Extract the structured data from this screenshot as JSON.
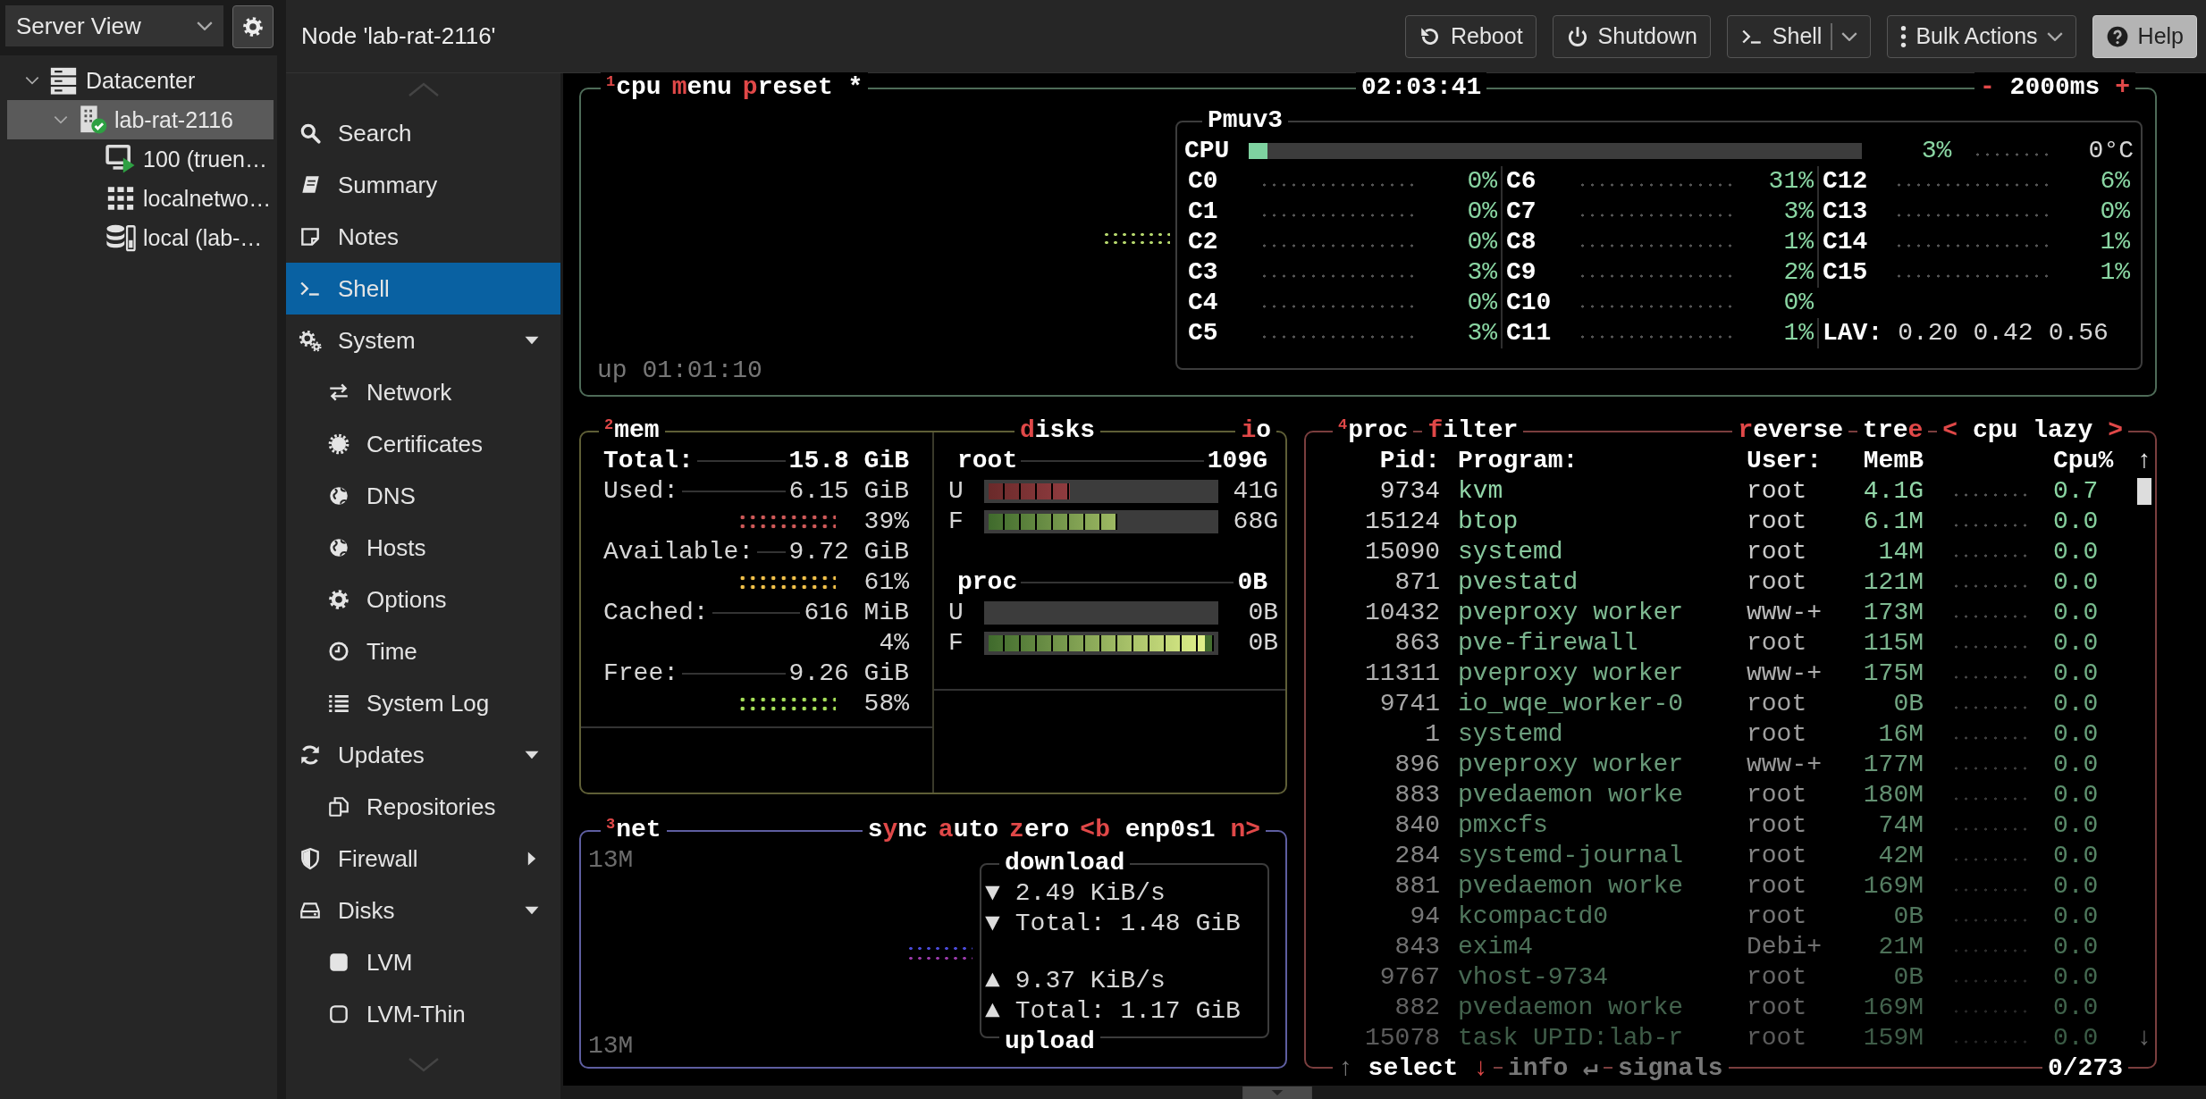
{
  "tree": {
    "view_selector": "Server View",
    "items": [
      {
        "label": "Datacenter",
        "kind": "datacenter",
        "selected": false,
        "expanded": true,
        "children": [
          {
            "label": "lab-rat-2116",
            "kind": "node",
            "selected": true,
            "expanded": true,
            "children": [
              {
                "label": "100 (truen…",
                "kind": "vm",
                "selected": false
              },
              {
                "label": "localnetwo…",
                "kind": "network",
                "selected": false
              },
              {
                "label": "local (lab-…",
                "kind": "storage",
                "selected": false
              }
            ]
          }
        ]
      }
    ]
  },
  "header": {
    "title": "Node 'lab-rat-2116'",
    "buttons": [
      {
        "label": "Reboot",
        "kind": "plain"
      },
      {
        "label": "Shutdown",
        "kind": "plain"
      },
      {
        "label": "Shell",
        "kind": "split"
      },
      {
        "label": "Bulk Actions",
        "kind": "dropdown"
      },
      {
        "label": "Help",
        "kind": "light"
      }
    ]
  },
  "nav": {
    "items": [
      {
        "label": "Search",
        "kind": "search",
        "selected": false
      },
      {
        "label": "Summary",
        "kind": "summary",
        "selected": false
      },
      {
        "label": "Notes",
        "kind": "notes",
        "selected": false
      },
      {
        "label": "Shell",
        "kind": "shell",
        "selected": true
      },
      {
        "label": "System",
        "kind": "system",
        "selected": false,
        "expanded": true,
        "children": [
          {
            "label": "Network",
            "kind": "network",
            "selected": false
          },
          {
            "label": "Certificates",
            "kind": "certificates",
            "selected": false
          },
          {
            "label": "DNS",
            "kind": "globe",
            "selected": false
          },
          {
            "label": "Hosts",
            "kind": "globe",
            "selected": false
          },
          {
            "label": "Options",
            "kind": "options",
            "selected": false
          },
          {
            "label": "Time",
            "kind": "time",
            "selected": false
          },
          {
            "label": "System Log",
            "kind": "log",
            "selected": false
          }
        ]
      },
      {
        "label": "Updates",
        "kind": "updates",
        "selected": false,
        "expanded": true,
        "children": [
          {
            "label": "Repositories",
            "kind": "repositories",
            "selected": false
          }
        ]
      },
      {
        "label": "Firewall",
        "kind": "firewall",
        "selected": false,
        "expanded": false
      },
      {
        "label": "Disks",
        "kind": "disks",
        "selected": false,
        "expanded": true,
        "children": [
          {
            "label": "LVM",
            "kind": "lvm",
            "selected": false
          },
          {
            "label": "LVM-Thin",
            "kind": "lvmthin",
            "selected": false
          }
        ]
      }
    ]
  },
  "cpu_panel": {
    "tabs": [
      {
        "number": "1",
        "parts": [
          {
            "text": "cpu",
            "kind": "text"
          }
        ]
      },
      {
        "parts": [
          {
            "text": "m",
            "kind": "key"
          },
          {
            "text": "enu",
            "kind": "text"
          }
        ]
      },
      {
        "parts": [
          {
            "text": "p",
            "kind": "key"
          },
          {
            "text": "reset *",
            "kind": "text"
          }
        ]
      }
    ],
    "clock": "02:03:41",
    "right_tabs": [
      {
        "parts": [
          {
            "text": "-",
            "kind": "key"
          },
          {
            "text": " 2000ms ",
            "kind": "text"
          },
          {
            "text": "+",
            "kind": "key"
          }
        ]
      }
    ],
    "uptime": "up 01:01:10",
    "sensor": {
      "title": "Pmuv3",
      "label": "CPU",
      "level": 0.03,
      "percent": "3%",
      "temp": "0°C",
      "cores": [
        {
          "name": "C0",
          "percent": "0%"
        },
        {
          "name": "C1",
          "percent": "0%"
        },
        {
          "name": "C2",
          "percent": "0%"
        },
        {
          "name": "C3",
          "percent": "3%"
        },
        {
          "name": "C4",
          "percent": "0%"
        },
        {
          "name": "C5",
          "percent": "3%"
        },
        {
          "name": "C6",
          "percent": "31%"
        },
        {
          "name": "C7",
          "percent": "3%"
        },
        {
          "name": "C8",
          "percent": "1%"
        },
        {
          "name": "C9",
          "percent": "2%"
        },
        {
          "name": "C10",
          "percent": "0%"
        },
        {
          "name": "C11",
          "percent": "1%"
        },
        {
          "name": "C12",
          "percent": "6%"
        },
        {
          "name": "C13",
          "percent": "0%"
        },
        {
          "name": "C14",
          "percent": "1%"
        },
        {
          "name": "C15",
          "percent": "1%"
        }
      ],
      "lav": {
        "label": "LAV:",
        "values": [
          "0.20",
          "0.42",
          "0.56"
        ]
      }
    }
  },
  "mem_panel": {
    "tabs": [
      {
        "number": "2",
        "parts": [
          {
            "text": "mem",
            "kind": "text"
          }
        ]
      }
    ],
    "total": {
      "label": "Total:",
      "value": "15.8 GiB"
    },
    "rows": [
      {
        "label": "Used:",
        "value": "6.15 GiB",
        "percent": "39%",
        "color": "#d05a5a"
      },
      {
        "label": "Available:",
        "value": "9.72 GiB",
        "percent": "61%",
        "color": "#f2c14a"
      },
      {
        "label": "Cached:",
        "value": "616 MiB",
        "percent": "4%"
      },
      {
        "label": "Free:",
        "value": "9.26 GiB",
        "percent": "58%",
        "color": "#a6e05a"
      }
    ],
    "disks": {
      "tabs": [
        {
          "parts": [
            {
              "text": "d",
              "kind": "key"
            },
            {
              "text": "isks",
              "kind": "text"
            }
          ]
        }
      ],
      "right_tabs": [
        {
          "parts": [
            {
              "text": "i",
              "kind": "key"
            },
            {
              "text": "o",
              "kind": "text"
            }
          ]
        }
      ],
      "items": [
        {
          "name": "root",
          "size": "109G",
          "bars": [
            {
              "label": "U",
              "kind": "used",
              "level": 0.36,
              "value": "41G"
            },
            {
              "label": "F",
              "kind": "free",
              "level": 0.57,
              "value": "68G"
            }
          ]
        },
        {
          "name": "proc",
          "size": "0B",
          "bars": [
            {
              "label": "U",
              "kind": "used",
              "value": "0B"
            },
            {
              "label": "F",
              "kind": "free",
              "level": 1,
              "value": "0B"
            }
          ]
        }
      ]
    }
  },
  "net_panel": {
    "tabs": [
      {
        "number": "3",
        "parts": [
          {
            "text": "net",
            "kind": "text"
          }
        ]
      }
    ],
    "right_tabs": [
      {
        "parts": [
          {
            "text": "s",
            "kind": "text"
          },
          {
            "text": "y",
            "kind": "key"
          },
          {
            "text": "nc",
            "kind": "text"
          }
        ]
      },
      {
        "parts": [
          {
            "text": "a",
            "kind": "key"
          },
          {
            "text": "uto",
            "kind": "text"
          }
        ]
      },
      {
        "parts": [
          {
            "text": "z",
            "kind": "key"
          },
          {
            "text": "ero",
            "kind": "text"
          }
        ]
      },
      {
        "parts": [
          {
            "text": "<b ",
            "kind": "key"
          },
          {
            "text": "enp0s1",
            "kind": "text"
          },
          {
            "text": " n>",
            "kind": "key"
          }
        ]
      }
    ],
    "scale_top": "13M",
    "scale_bottom": "13M",
    "stats": {
      "top_title": "download",
      "bottom_title": "upload",
      "download": [
        {
          "arrow": "▼",
          "text": "2.49 KiB/s"
        },
        {
          "arrow": "▼",
          "text": "Total: 1.48 GiB"
        }
      ],
      "upload": [
        {
          "arrow": "▲",
          "text": "9.37 KiB/s"
        },
        {
          "arrow": "▲",
          "text": "Total: 1.17 GiB"
        }
      ]
    }
  },
  "proc_panel": {
    "tabs": [
      {
        "number": "4",
        "parts": [
          {
            "text": "proc",
            "kind": "text"
          }
        ]
      },
      {
        "parts": [
          {
            "text": "f",
            "kind": "key"
          },
          {
            "text": "ilter",
            "kind": "text"
          }
        ]
      }
    ],
    "right_tabs": [
      {
        "parts": [
          {
            "text": "r",
            "kind": "key"
          },
          {
            "text": "everse",
            "kind": "text"
          }
        ]
      },
      {
        "parts": [
          {
            "text": "tre",
            "kind": "text"
          },
          {
            "text": "e",
            "kind": "key"
          }
        ]
      },
      {
        "parts": [
          {
            "text": "<",
            "kind": "key"
          },
          {
            "text": " cpu lazy ",
            "kind": "text"
          },
          {
            "text": ">",
            "kind": "key"
          }
        ]
      }
    ],
    "columns": [
      "Pid:",
      "Program:",
      "User:",
      "MemB",
      "Cpu%"
    ],
    "scroll_up": "↑",
    "scroll_down": "↓",
    "rows": [
      {
        "pid": "9734",
        "program": "kvm",
        "user": "root",
        "mem": "4.1G",
        "cpu": "0.7"
      },
      {
        "pid": "15124",
        "program": "btop",
        "user": "root",
        "mem": "6.1M",
        "cpu": "0.0"
      },
      {
        "pid": "15090",
        "program": "systemd",
        "user": "root",
        "mem": "14M",
        "cpu": "0.0"
      },
      {
        "pid": "871",
        "program": "pvestatd",
        "user": "root",
        "mem": "121M",
        "cpu": "0.0"
      },
      {
        "pid": "10432",
        "program": "pveproxy worker",
        "user": "www-+",
        "mem": "173M",
        "cpu": "0.0"
      },
      {
        "pid": "863",
        "program": "pve-firewall",
        "user": "root",
        "mem": "115M",
        "cpu": "0.0"
      },
      {
        "pid": "11311",
        "program": "pveproxy worker",
        "user": "www-+",
        "mem": "175M",
        "cpu": "0.0"
      },
      {
        "pid": "9741",
        "program": "io_wqe_worker-0",
        "user": "root",
        "mem": "0B",
        "cpu": "0.0"
      },
      {
        "pid": "1",
        "program": "systemd",
        "user": "root",
        "mem": "16M",
        "cpu": "0.0"
      },
      {
        "pid": "896",
        "program": "pveproxy worker",
        "user": "www-+",
        "mem": "177M",
        "cpu": "0.0"
      },
      {
        "pid": "883",
        "program": "pvedaemon worke",
        "user": "root",
        "mem": "180M",
        "cpu": "0.0"
      },
      {
        "pid": "840",
        "program": "pmxcfs",
        "user": "root",
        "mem": "74M",
        "cpu": "0.0"
      },
      {
        "pid": "284",
        "program": "systemd-journal",
        "user": "root",
        "mem": "42M",
        "cpu": "0.0"
      },
      {
        "pid": "881",
        "program": "pvedaemon worke",
        "user": "root",
        "mem": "169M",
        "cpu": "0.0"
      },
      {
        "pid": "94",
        "program": "kcompactd0",
        "user": "root",
        "mem": "0B",
        "cpu": "0.0"
      },
      {
        "pid": "843",
        "program": "exim4",
        "user": "Debi+",
        "mem": "21M",
        "cpu": "0.0"
      },
      {
        "pid": "9767",
        "program": "vhost-9734",
        "user": "root",
        "mem": "0B",
        "cpu": "0.0"
      },
      {
        "pid": "882",
        "program": "pvedaemon worke",
        "user": "root",
        "mem": "169M",
        "cpu": "0.0"
      },
      {
        "pid": "15078",
        "program": "task UPID:lab-r",
        "user": "root",
        "mem": "159M",
        "cpu": "0.0"
      }
    ],
    "footer_tabs": [
      {
        "parts": [
          {
            "text": "↑ ",
            "kind": "dim"
          },
          {
            "text": "select",
            "kind": "text"
          },
          {
            "text": " ↓",
            "kind": "key"
          }
        ]
      },
      {
        "parts": [
          {
            "text": "info ↵",
            "kind": "dim"
          }
        ]
      },
      {
        "parts": [
          {
            "text": "signals",
            "kind": "dim"
          }
        ]
      }
    ],
    "count": "0/273"
  }
}
